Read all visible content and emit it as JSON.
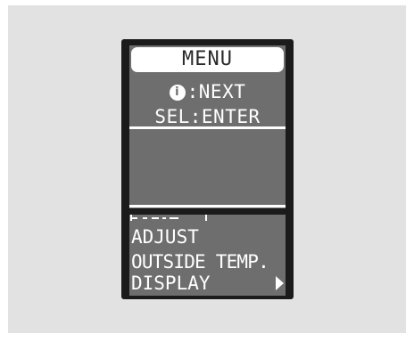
{
  "menu": {
    "title": "MENU",
    "hint_next": ":NEXT",
    "hint_enter": "SEL:ENTER",
    "info_icon_glyph": "i",
    "items": [
      "ADJUST",
      "OUTSIDE TEMP.",
      "DISPLAY"
    ],
    "submenu_icon": "right-arrow-icon"
  },
  "colors": {
    "screen_bg": "#6e6e6e",
    "screen_fg": "#ffffff",
    "bezel": "#1b1b1b",
    "backdrop": "#e2e2e3"
  }
}
